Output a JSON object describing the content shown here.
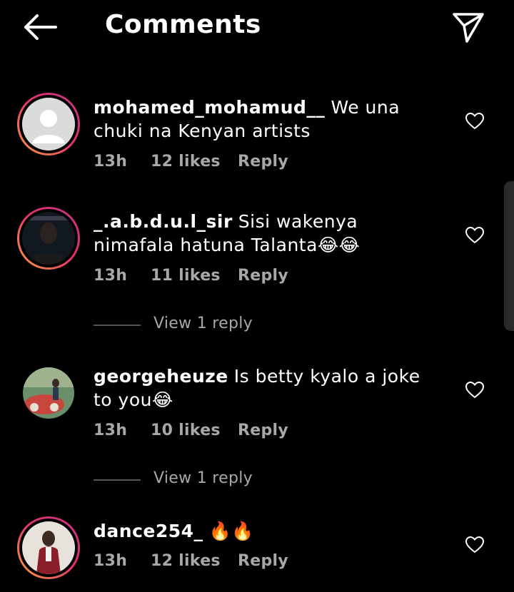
{
  "header": {
    "title": "Comments",
    "back_icon": "arrow-left-icon",
    "send_icon": "send-icon"
  },
  "comments": [
    {
      "username": "mohamed_mohamud__",
      "text": "We una chuki na Kenyan artists",
      "time": "13h",
      "likes": "12 likes",
      "reply": "Reply",
      "avatar": "default-avatar",
      "story_ring": true
    },
    {
      "username": "_.a.b.d.u.l_sir",
      "text": "Sisi wakenya nimafala hatuna Talanta😂😂",
      "time": "13h",
      "likes": "11 likes",
      "reply": "Reply",
      "avatar": "photo-avatar",
      "story_ring": true,
      "view_replies": "View 1 reply"
    },
    {
      "username": "georgeheuze",
      "text": "Is betty kyalo a joke to you😂",
      "time": "13h",
      "likes": "10 likes",
      "reply": "Reply",
      "avatar": "photo-avatar",
      "story_ring": false,
      "view_replies": "View 1 reply"
    },
    {
      "username": "dance254_",
      "text": "🔥🔥",
      "time": "13h",
      "likes": "12 likes",
      "reply": "Reply",
      "avatar": "photo-avatar",
      "story_ring": true
    }
  ],
  "colors": {
    "background": "#000000",
    "meta_text": "#a8a8a8",
    "ring_start": "#f9a03f",
    "ring_end": "#c13584"
  }
}
